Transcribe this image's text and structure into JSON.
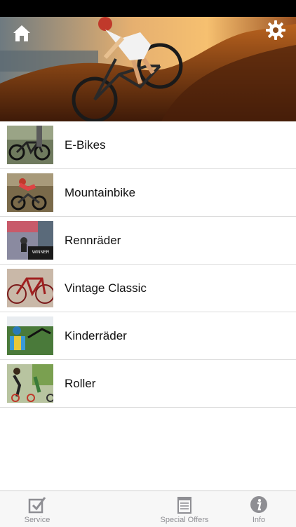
{
  "header": {
    "home_icon": "home-icon",
    "settings_icon": "gear-icon"
  },
  "categories": [
    {
      "label": "E-Bikes",
      "thumb": "e-bike-photo"
    },
    {
      "label": "Mountainbike",
      "thumb": "mountainbike-photo"
    },
    {
      "label": "Rennräder",
      "thumb": "road-bike-photo",
      "badge_lines": [
        "WINNER"
      ]
    },
    {
      "label": "Vintage Classic",
      "thumb": "vintage-bike-photo"
    },
    {
      "label": "Kinderräder",
      "thumb": "kids-bike-photo"
    },
    {
      "label": "Roller",
      "thumb": "scooter-photo"
    }
  ],
  "tabs": [
    {
      "label": "Service",
      "icon": "checkbox-icon"
    },
    {
      "label": "Special Offers",
      "icon": "notepad-icon"
    },
    {
      "label": "Info",
      "icon": "info-icon"
    }
  ],
  "colors": {
    "accent": "#f0a030",
    "tab_inactive": "#8e8e93",
    "divider": "#dcdcdc"
  }
}
